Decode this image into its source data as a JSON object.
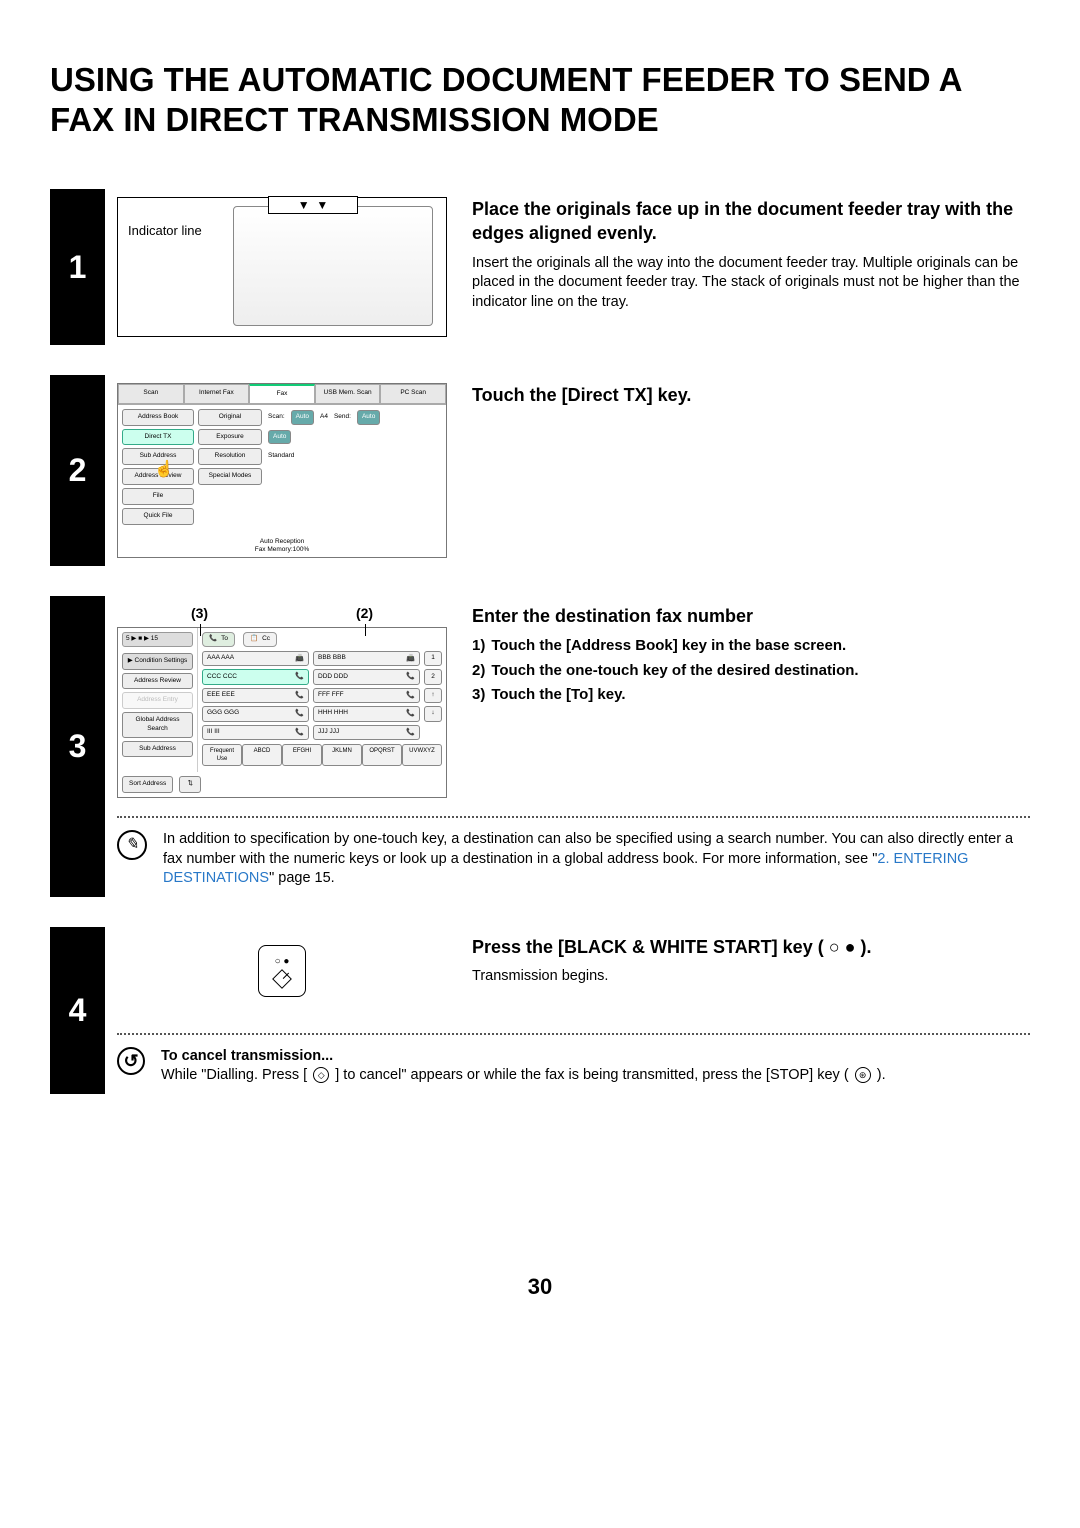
{
  "title": "USING THE AUTOMATIC DOCUMENT FEEDER TO SEND A FAX IN DIRECT TRANSMISSION MODE",
  "page_number": "30",
  "step1": {
    "num": "1",
    "indicator_label": "Indicator line",
    "heading": "Place the originals face up in the document feeder tray with the edges aligned evenly.",
    "para": "Insert the originals all the way into the document feeder tray. Multiple originals can be placed in the document feeder tray. The stack of originals must not be higher than the indicator line on the tray."
  },
  "step2": {
    "num": "2",
    "heading": "Touch the [Direct TX] key.",
    "tabs": [
      "Scan",
      "Internet Fax",
      "Fax",
      "USB Mem. Scan",
      "PC Scan"
    ],
    "left_buttons": [
      "Address Book",
      "Direct TX",
      "Sub Address",
      "Address Review",
      "File",
      "Quick File"
    ],
    "right_rows": [
      {
        "label": "Original",
        "vals": [
          "Scan:",
          "Auto",
          "A4",
          "Send:",
          "Auto"
        ]
      },
      {
        "label": "Exposure",
        "vals": [
          "Auto"
        ]
      },
      {
        "label": "Resolution",
        "text": "Standard"
      },
      {
        "label": "Special Modes"
      }
    ],
    "footer1": "Auto Reception",
    "footer2": "Fax Memory:100%"
  },
  "step3": {
    "num": "3",
    "heading": "Enter the destination fax number",
    "callouts": [
      "(3)",
      "(2)"
    ],
    "top_chips": {
      "to": "To",
      "cc": "Cc"
    },
    "left_nav": "5 ▶ ■ ▶ 15",
    "side_buttons": [
      "Condition Settings",
      "Address Review",
      "Address Entry",
      "Global Address Search",
      "Sub Address"
    ],
    "sort_label": "Sort Address",
    "list_rows": [
      [
        "AAA AAA",
        "BBB BBB",
        "1"
      ],
      [
        "CCC CCC",
        "DDD DDD",
        "2"
      ],
      [
        "EEE EEE",
        "FFF FFF",
        "↑"
      ],
      [
        "GGG GGG",
        "HHH HHH",
        "↓"
      ],
      [
        "III III",
        "JJJ JJJ",
        ""
      ]
    ],
    "tab_row": [
      "Frequent Use",
      "ABCD",
      "EFGHI",
      "JKLMN",
      "OPQRST",
      "UVWXYZ"
    ],
    "ol": [
      {
        "n": "1)",
        "t": "Touch the [Address Book] key in the base screen."
      },
      {
        "n": "2)",
        "t": "Touch the one-touch key of the desired destination."
      },
      {
        "n": "3)",
        "t": "Touch the [To] key."
      }
    ],
    "note_pre": "In addition to specification by one-touch key, a destination can also be specified using a search number. You can also directly enter a fax number with the numeric keys or look up a destination in a global address book. For more information, see \"",
    "note_link": "2. ENTERING DESTINATIONS",
    "note_post": "\" page 15."
  },
  "step4": {
    "num": "4",
    "heading": "Press the [BLACK & WHITE START] key ( ○ ● ).",
    "para": "Transmission begins.",
    "cancel_title": "To cancel transmission...",
    "cancel_text_a": "While \"Dialling. Press [",
    "cancel_text_b": "] to cancel\" appears or while the fax is being transmitted, press the [STOP] key (",
    "cancel_text_c": ")."
  }
}
